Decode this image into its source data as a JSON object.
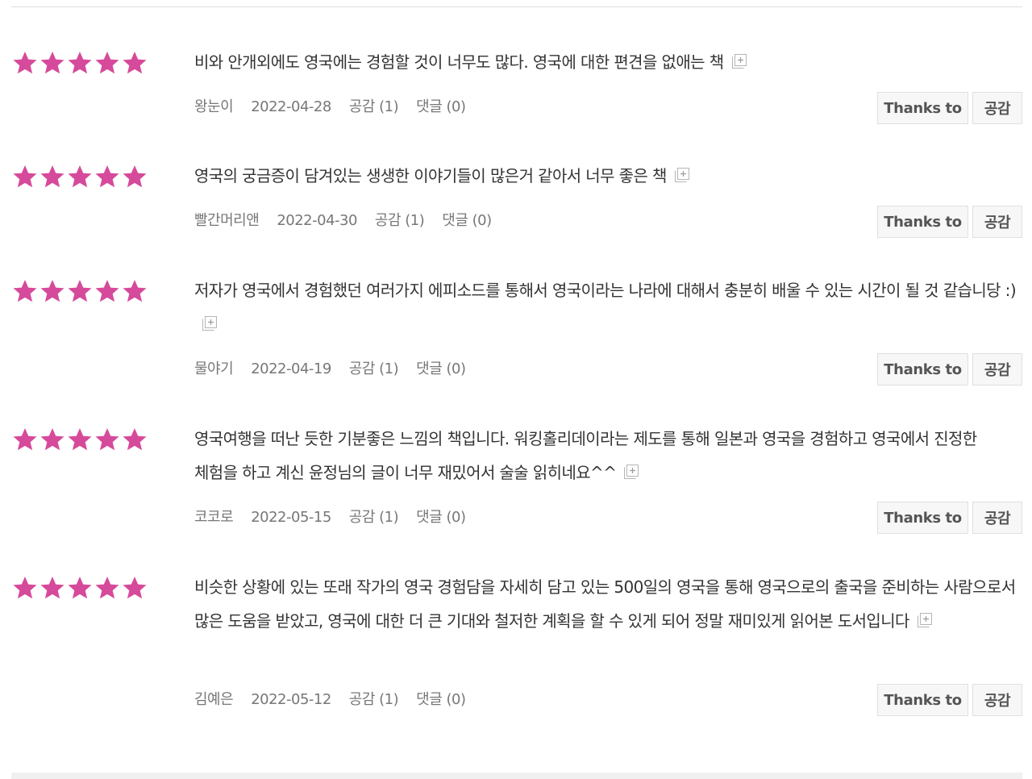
{
  "colors": {
    "star": "#d64a9b",
    "text": "#333333",
    "meta": "#777777"
  },
  "reviews": [
    {
      "rating": 5,
      "text": "비와 안개외에도 영국에는 경험할 것이 너무도 많다. 영국에 대한 편견을 없애는 책",
      "author": "왕눈이",
      "date": "2022-04-28",
      "likes": "공감 (1)",
      "comments": "댓글 (0)",
      "thanks_label": "Thanks to",
      "like_label": "공감"
    },
    {
      "rating": 5,
      "text": "영국의 궁금증이 담겨있는 생생한 이야기들이 많은거 같아서 너무 좋은 책",
      "author": "빨간머리앤",
      "date": "2022-04-30",
      "likes": "공감 (1)",
      "comments": "댓글 (0)",
      "thanks_label": "Thanks to",
      "like_label": "공감"
    },
    {
      "rating": 5,
      "text": "저자가 영국에서 경험했던 여러가지 에피소드를 통해서 영국이라는 나라에 대해서 충분히 배울 수 있는 시간이 될 것 같습니당 :)",
      "author": "물야기",
      "date": "2022-04-19",
      "likes": "공감 (1)",
      "comments": "댓글 (0)",
      "thanks_label": "Thanks to",
      "like_label": "공감"
    },
    {
      "rating": 5,
      "text": "영국여행을 떠난 듯한 기분좋은 느낌의 책입니다. 워킹홀리데이라는 제도를 통해 일본과 영국을 경험하고 영국에서 진정한 체험을 하고 계신 윤정님의 글이 너무 재밌어서 술술 읽히네요^^",
      "author": "코코로",
      "date": "2022-05-15",
      "likes": "공감 (1)",
      "comments": "댓글 (0)",
      "thanks_label": "Thanks to",
      "like_label": "공감"
    },
    {
      "rating": 5,
      "text": "비슷한 상황에 있는 또래 작가의 영국 경험담을 자세히 담고 있는 500일의 영국을 통해 영국으로의 출국을 준비하는 사람으로서 많은 도움을 받았고, 영국에 대한 더 큰 기대와 철저한 계획을 할 수 있게 되어 정말 재미있게 읽어본 도서입니다",
      "author": "김예은",
      "date": "2022-05-12",
      "likes": "공감 (1)",
      "comments": "댓글 (0)",
      "thanks_label": "Thanks to",
      "like_label": "공감"
    }
  ]
}
